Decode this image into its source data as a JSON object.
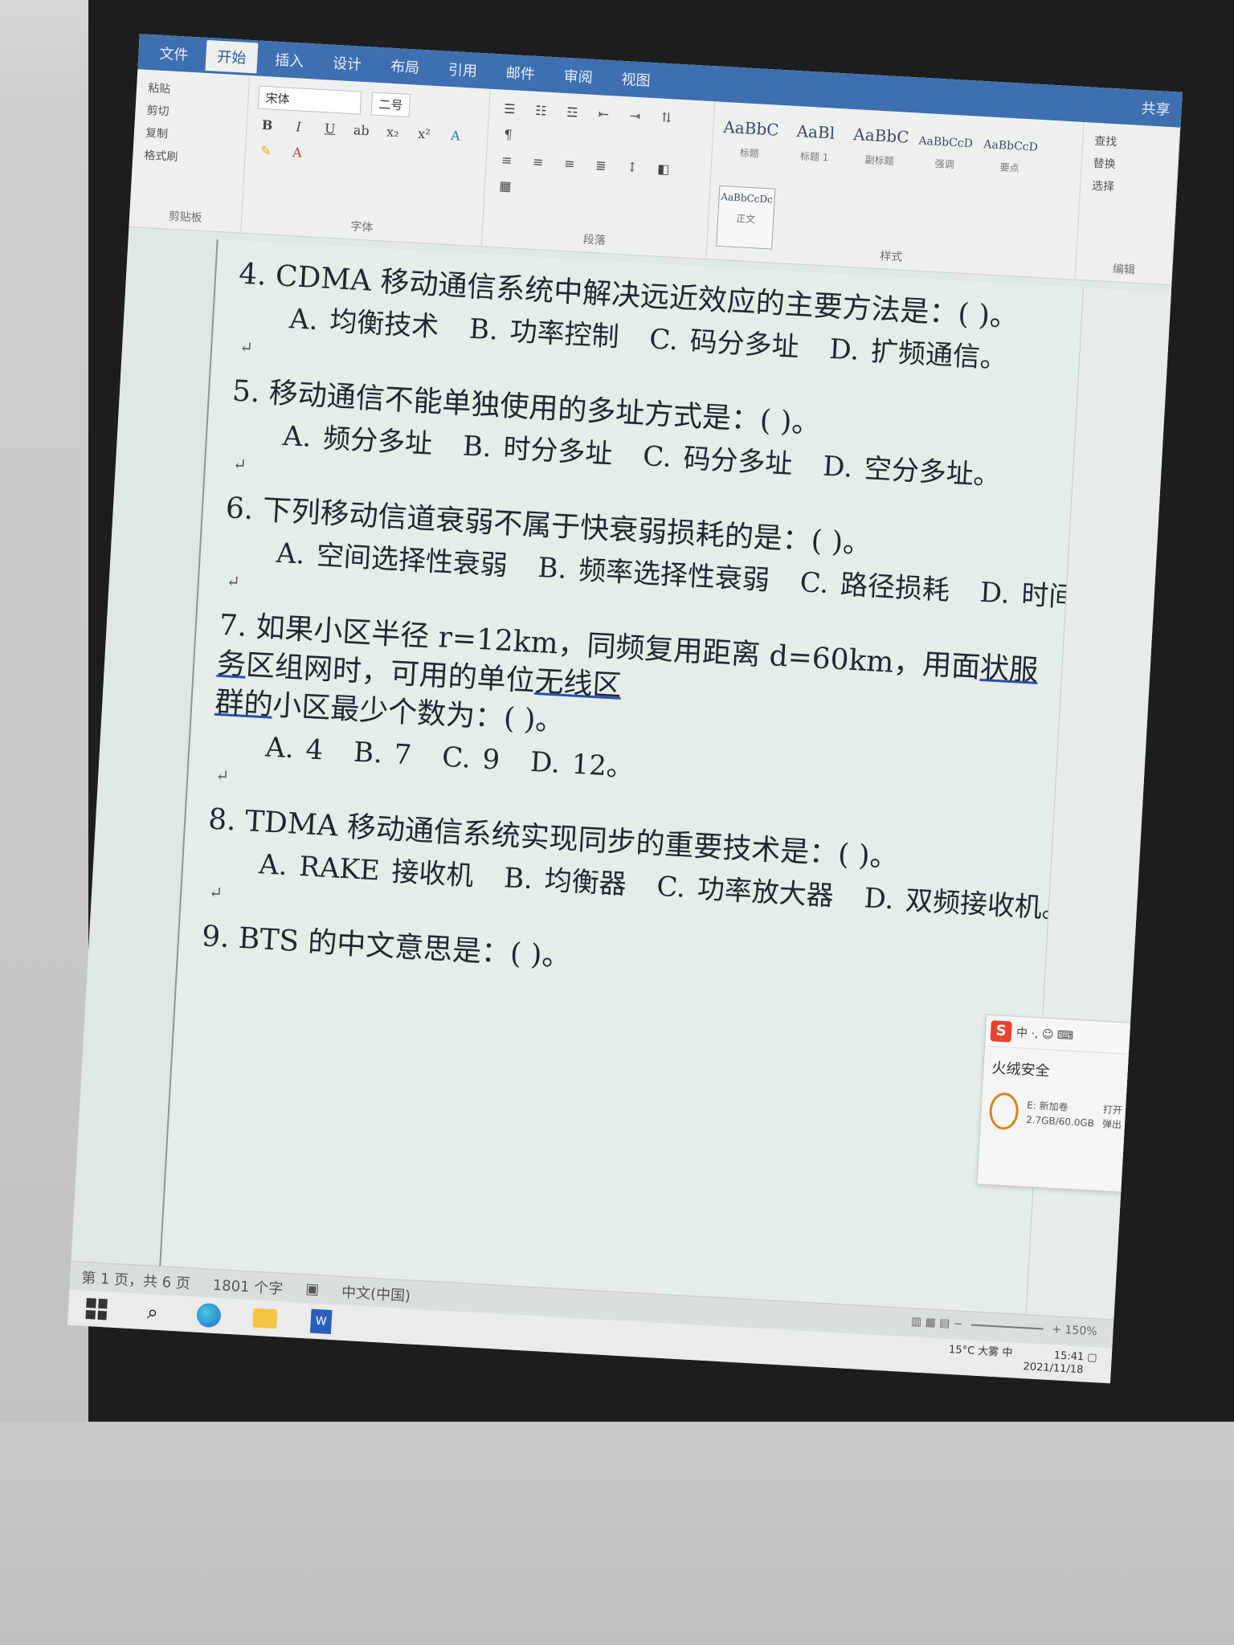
{
  "ribbon": {
    "tabs": [
      "文件",
      "开始",
      "插入",
      "设计",
      "布局",
      "引用",
      "邮件",
      "审阅",
      "视图"
    ],
    "clipboard": {
      "paste": "粘贴",
      "cut": "剪切",
      "copy": "复制",
      "format_painter": "格式刷",
      "label": "剪贴板"
    },
    "font": {
      "name": "宋体",
      "size": "二号",
      "label": "字体"
    },
    "paragraph_label": "段落",
    "styles": [
      {
        "sample": "AaBbC",
        "name": "标题"
      },
      {
        "sample": "AaBl",
        "name": "标题 1"
      },
      {
        "sample": "AaBbC",
        "name": "副标题"
      },
      {
        "sample": "AaBbCcD",
        "name": "强调"
      },
      {
        "sample": "AaBbCcD",
        "name": "要点"
      },
      {
        "sample": "AaBbCcDc",
        "name": "正文"
      }
    ],
    "styles_label": "样式",
    "editing": {
      "find": "查找",
      "replace": "替换",
      "select": "选择",
      "label": "编辑"
    },
    "share": "共享"
  },
  "document": {
    "q4": {
      "question": "4. CDMA 移动通信系统中解决远近效应的主要方法是：(    )。",
      "options": [
        "A. 均衡技术",
        "B. 功率控制",
        "C. 码分多址",
        "D. 扩频通信。"
      ]
    },
    "q5": {
      "question": "5. 移动通信不能单独使用的多址方式是：(    )。",
      "options": [
        "A. 频分多址",
        "B. 时分多址",
        "C. 码分多址",
        "D. 空分多址。"
      ]
    },
    "q6": {
      "question": "6. 下列移动信道衰弱不属于快衰弱损耗的是：(    )。",
      "options": [
        "A. 空间选择性衰弱",
        "B. 频率选择性衰弱",
        "C. 路径损耗",
        "D. 时间间选择性衰弱。"
      ]
    },
    "q7": {
      "line1_a": "7. 如果小区半径 r=12km，同频复用距离 d=60km，用面",
      "line1_u1": "状服务",
      "line1_b": "区组网时，可用的单位",
      "line1_u2": "无线区",
      "line2_u": "群的",
      "line2_b": "小区最少个数为：(    )。",
      "options": [
        "A. 4",
        "B. 7",
        "C. 9",
        "D. 12。"
      ]
    },
    "q8": {
      "question": "8. TDMA 移动通信系统实现同步的重要技术是：(    )。",
      "options": [
        "A. RAKE 接收机",
        "B. 均衡器",
        "C. 功率放大器",
        "D. 双频接收机。"
      ]
    },
    "q9": {
      "question": "9. BTS 的中文意思是：(    )。"
    },
    "paragraph_mark": "↵"
  },
  "popup": {
    "app_icon": "S",
    "ime": "中 ·, ☺ ⌨",
    "title": "火绒安全",
    "disk_label": "E: 新加卷",
    "disk_usage": "2.7GB/60.0GB",
    "open": "打开",
    "eject": "弹出"
  },
  "statusbar": {
    "page": "第 1 页，共 6 页",
    "words": "1801 个字",
    "language": "中文(中国)",
    "zoom": "150%"
  },
  "taskbar": {
    "weather": "15°C 大雾",
    "ime_state": "中",
    "time": "15:41",
    "date": "2021/11/18"
  },
  "colors": {
    "ribbon_blue": "#3e6fb0",
    "page_bg": "#e4ede8",
    "underline_blue": "#2c4fb5"
  }
}
